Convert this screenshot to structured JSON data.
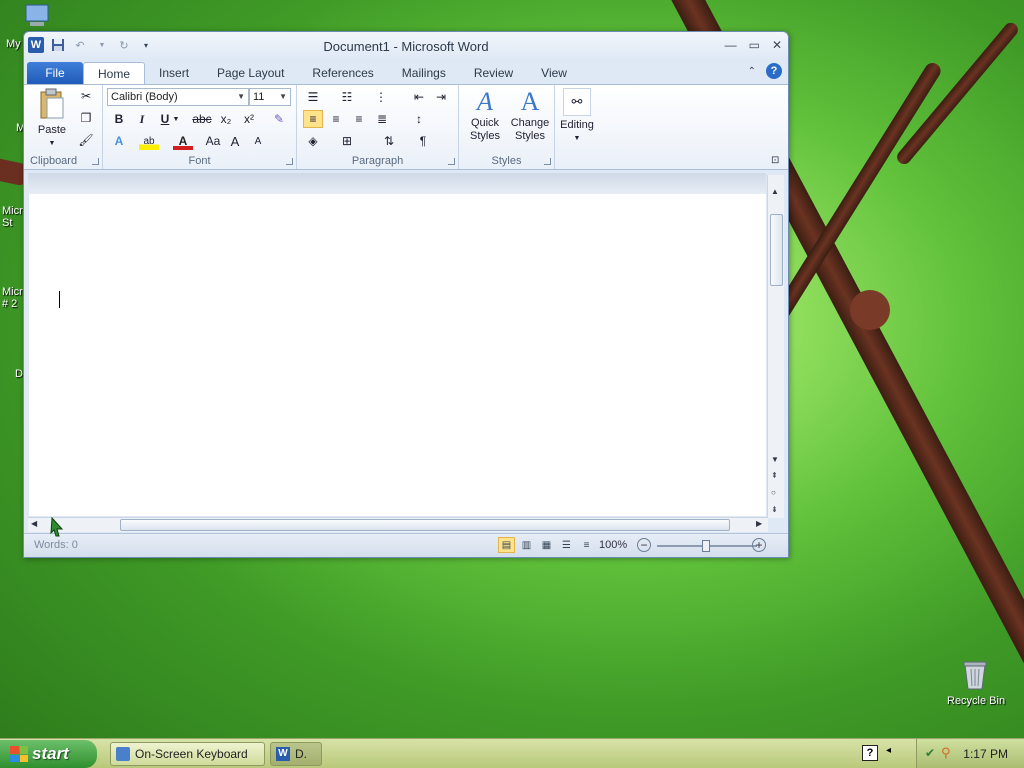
{
  "window": {
    "title": "Document1  -  Microsoft Word",
    "qat": {
      "word_logo": "W",
      "save": "💾",
      "undo": "↶",
      "redo": "↻"
    },
    "controls": {
      "minimize": "—",
      "maximize": "▭",
      "close": "✕"
    }
  },
  "tabs": {
    "file": "File",
    "items": [
      "Home",
      "Insert",
      "Page Layout",
      "References",
      "Mailings",
      "Review",
      "View"
    ]
  },
  "ribbon": {
    "clipboard": {
      "label": "Clipboard",
      "paste": "Paste"
    },
    "font": {
      "label": "Font",
      "font_name": "Calibri (Body)",
      "font_size": "11",
      "bold": "B",
      "italic": "I",
      "underline": "U",
      "strike": "abc",
      "subscript": "x₂",
      "superscript": "x²",
      "grow": "A",
      "shrink": "A",
      "change_case": "Aa"
    },
    "paragraph": {
      "label": "Paragraph",
      "pilcrow": "¶"
    },
    "styles": {
      "label": "Styles",
      "quick_styles": "Quick\nStyles",
      "change_styles": "Change\nStyles"
    },
    "editing": {
      "label": "Editing"
    }
  },
  "status": {
    "words": "Words: 0",
    "zoom": "100%"
  },
  "desktop": {
    "icons": [
      {
        "label": "My"
      },
      {
        "label": "M"
      },
      {
        "label": "Micr\nSt"
      },
      {
        "label": "Micr\n# 2"
      },
      {
        "label": "D"
      }
    ],
    "recycle_bin": "Recycle Bin"
  },
  "taskbar": {
    "start": "start",
    "buttons": [
      "On-Screen Keyboard",
      "D."
    ],
    "clock": "1:17 PM"
  },
  "colors": {
    "accent": "#2a5cad",
    "file_tab": "#1f5bb8",
    "highlight": "#ffe38a"
  }
}
